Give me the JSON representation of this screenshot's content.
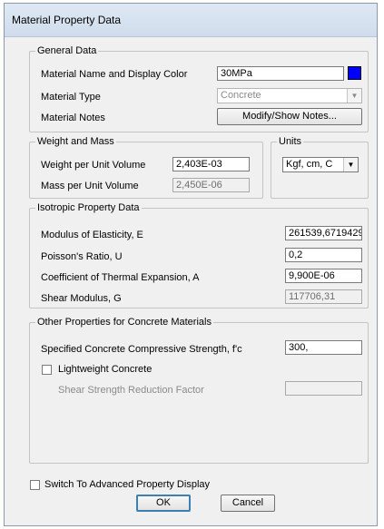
{
  "window": {
    "title": "Material Property Data"
  },
  "general": {
    "legend": "General Data",
    "name_label": "Material Name and Display Color",
    "name_value": "30MPa",
    "display_color": "#0000ff",
    "type_label": "Material Type",
    "type_value": "Concrete",
    "notes_label": "Material Notes",
    "notes_button": "Modify/Show Notes..."
  },
  "weight": {
    "legend": "Weight and Mass",
    "weight_label": "Weight per Unit Volume",
    "weight_value": "2,403E-03",
    "mass_label": "Mass per Unit Volume",
    "mass_value": "2,450E-06"
  },
  "units": {
    "legend": "Units",
    "value": "Kgf, cm, C"
  },
  "isotropic": {
    "legend": "Isotropic Property Data",
    "e_label": "Modulus of Elasticity,  E",
    "e_value": "261539,6719429",
    "u_label": "Poisson's Ratio,  U",
    "u_value": "0,2",
    "a_label": "Coefficient of Thermal Expansion,  A",
    "a_value": "9,900E-06",
    "g_label": "Shear Modulus,  G",
    "g_value": "117706,31"
  },
  "concrete": {
    "legend": "Other Properties for Concrete Materials",
    "fc_label": "Specified Concrete Compressive Strength, f'c",
    "fc_value": "300,",
    "lightweight_label": "Lightweight Concrete",
    "shear_factor_label": "Shear Strength Reduction Factor",
    "shear_factor_value": ""
  },
  "advanced_label": "Switch To Advanced Property Display",
  "buttons": {
    "ok": "OK",
    "cancel": "Cancel"
  }
}
